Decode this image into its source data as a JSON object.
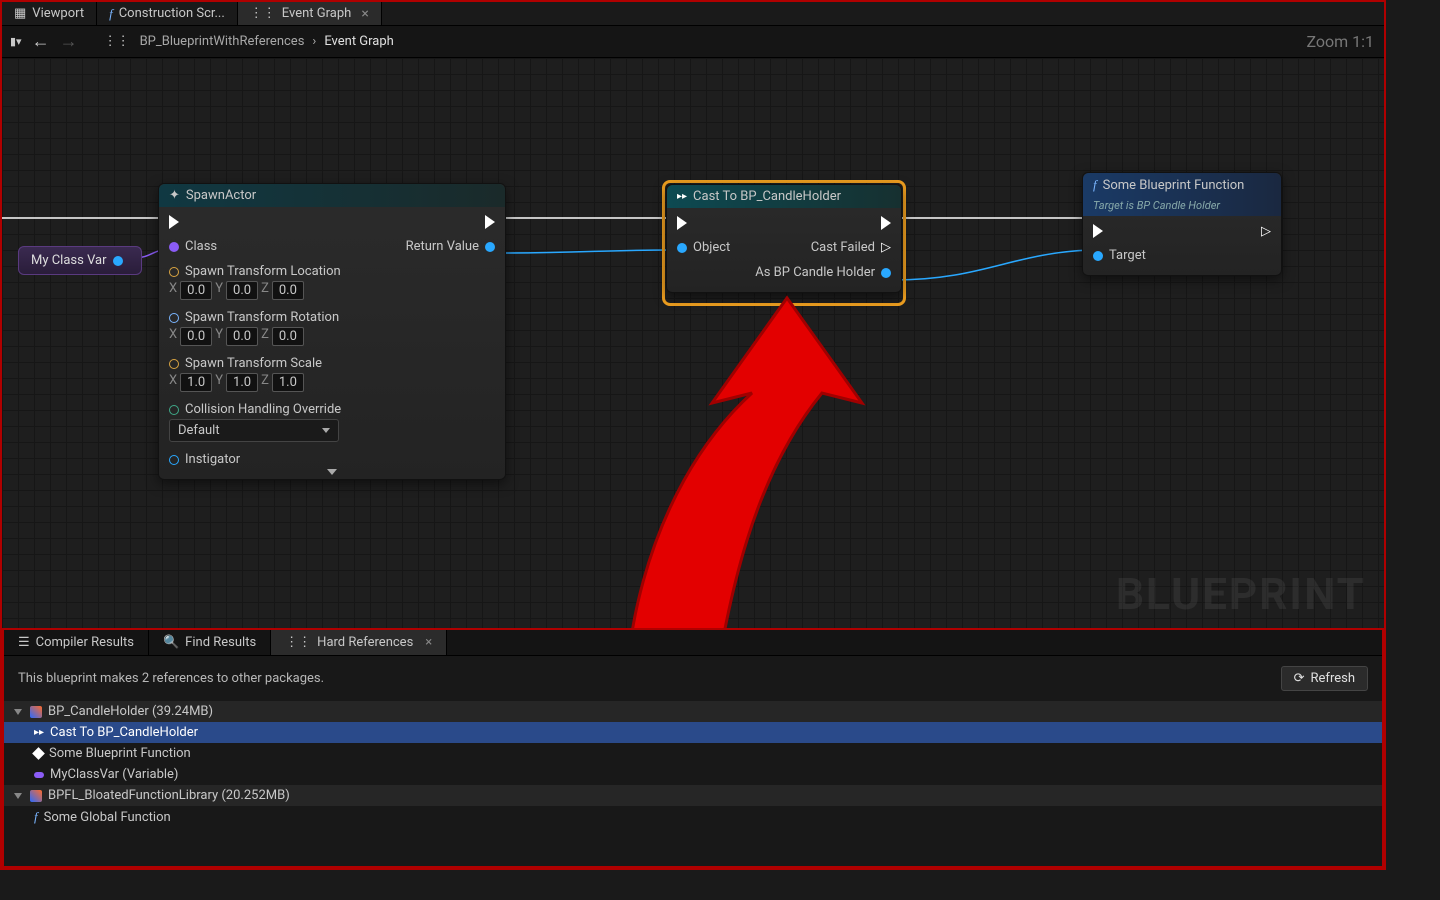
{
  "topTabs": {
    "viewport": "Viewport",
    "construction": "Construction Scr...",
    "eventGraph": "Event Graph"
  },
  "breadcrumb": {
    "blueprint": "BP_BlueprintWithReferences",
    "current": "Event Graph"
  },
  "zoom": "Zoom 1:1",
  "watermark": "BLUEPRINT",
  "varPill": "My Class Var",
  "spawn": {
    "title": "SpawnActor",
    "class": "Class",
    "loc": "Spawn Transform Location",
    "rot": "Spawn Transform Rotation",
    "scale": "Spawn Transform Scale",
    "collision": "Collision Handling Override",
    "collisionVal": "Default",
    "instigator": "Instigator",
    "returnValue": "Return Value",
    "x": "X",
    "y": "Y",
    "z": "Z",
    "zero": "0.0",
    "one": "1.0"
  },
  "cast": {
    "title": "Cast To BP_CandleHolder",
    "object": "Object",
    "castFailed": "Cast Failed",
    "asHolder": "As BP Candle Holder"
  },
  "func": {
    "title": "Some Blueprint Function",
    "subtitle": "Target is BP Candle Holder",
    "target": "Target"
  },
  "bottomTabs": {
    "compiler": "Compiler Results",
    "find": "Find Results",
    "hard": "Hard References"
  },
  "msg": "This blueprint makes 2 references to other packages.",
  "refresh": "Refresh",
  "tree": {
    "h1": "BP_CandleHolder (39.24MB)",
    "c1": "Cast To BP_CandleHolder",
    "c2": "Some Blueprint Function",
    "c3": "MyClassVar (Variable)",
    "h2": "BPFL_BloatedFunctionLibrary (20.252MB)",
    "c4": "Some Global Function"
  }
}
